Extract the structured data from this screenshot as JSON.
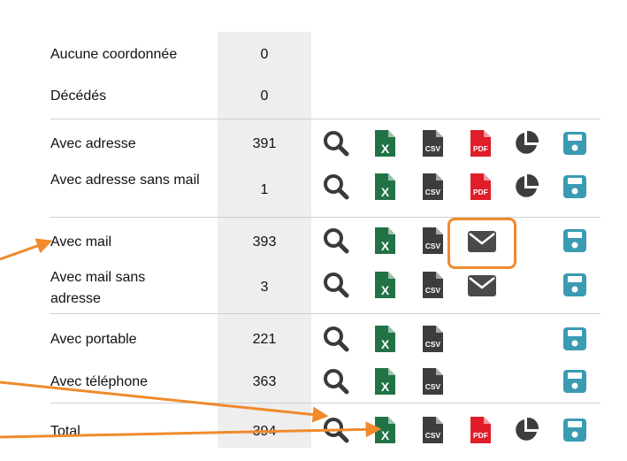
{
  "rows": [
    {
      "label": "Aucune coordonnée",
      "count": "0"
    },
    {
      "label": "Décédés",
      "count": "0"
    },
    {
      "label": "Avec adresse",
      "count": "391"
    },
    {
      "label": "Avec adresse sans mail",
      "count": "1"
    },
    {
      "label": "Avec mail",
      "count": "393"
    },
    {
      "label": "Avec mail sans adresse",
      "count": "3"
    },
    {
      "label": "Avec portable",
      "count": "221"
    },
    {
      "label": "Avec téléphone",
      "count": "363"
    },
    {
      "label": "Total",
      "count": "394"
    }
  ],
  "icons": {
    "excel_glyph": "X",
    "csv_glyph": "CSV",
    "pdf_glyph": "PDF"
  },
  "colors": {
    "search": "#3a3a3a",
    "excel": "#217346",
    "csv": "#3d3d3d",
    "pdf": "#e01e2a",
    "chart": "#3d3d3d",
    "mail": "#4a4a4a",
    "save": "#3a9bb3",
    "annotation": "#f08a2c"
  }
}
